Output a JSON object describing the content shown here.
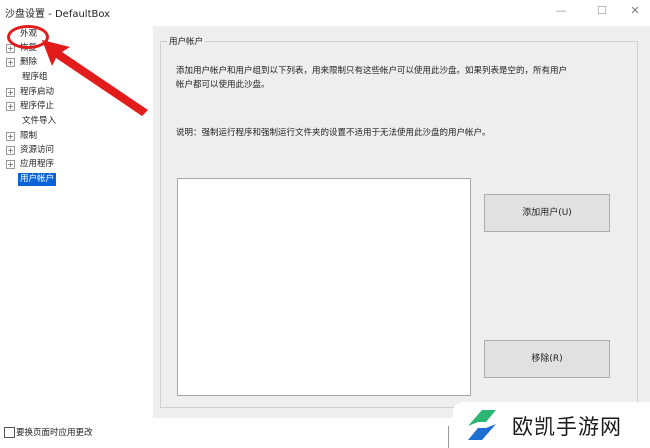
{
  "window": {
    "title": "沙盘设置 - DefaultBox",
    "min_glyph": "—",
    "max_glyph": "☐",
    "close_glyph": "✕"
  },
  "tree": {
    "items": [
      {
        "label": "外观",
        "expander": "",
        "child": false
      },
      {
        "label": "恢复",
        "expander": "+",
        "child": false
      },
      {
        "label": "删除",
        "expander": "+",
        "child": false
      },
      {
        "label": "程序组",
        "expander": "",
        "child": true
      },
      {
        "label": "程序启动",
        "expander": "+",
        "child": false
      },
      {
        "label": "程序停止",
        "expander": "+",
        "child": false
      },
      {
        "label": "文件导入",
        "expander": "",
        "child": true
      },
      {
        "label": "限制",
        "expander": "+",
        "child": false
      },
      {
        "label": "资源访问",
        "expander": "+",
        "child": false
      },
      {
        "label": "应用程序",
        "expander": "+",
        "child": false
      },
      {
        "label": "用户帐户",
        "expander": "",
        "child": true,
        "selected": true
      }
    ]
  },
  "panel": {
    "group_title": "用户帐户",
    "desc_line1": "添加用户帐户和用户组到以下列表，用来限制只有这些帐户可以使用此沙盘。如果列表是空的，所有用户",
    "desc_line2": "帐户都可以使用此沙盘。",
    "note": "说明：强制运行程序和强制运行文件夹的设置不适用于无法使用此沙盘的用户帐户。",
    "add_button": "添加用户(U)",
    "remove_button": "移除(R)"
  },
  "footer": {
    "checkbox_label": "要换页面时应用更改",
    "checkbox_checked": false
  },
  "watermark": {
    "text": "欧凯手游网"
  },
  "colors": {
    "selection": "#0a64d8",
    "annotation": "#e21b1b",
    "logo_green": "#2bb673",
    "logo_blue": "#1f6fd1"
  }
}
